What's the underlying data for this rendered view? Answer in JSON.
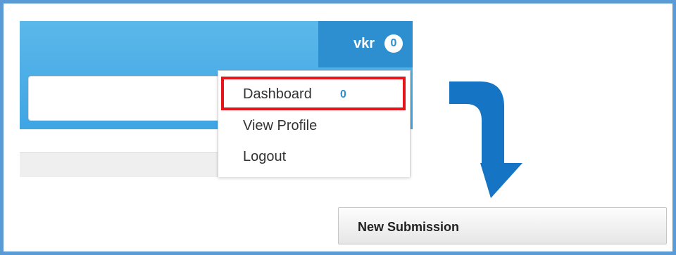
{
  "header": {
    "user_name": "vkr",
    "notification_count": "0"
  },
  "user_menu": {
    "items": [
      {
        "label": "Dashboard",
        "count": "0"
      },
      {
        "label": "View Profile"
      },
      {
        "label": "Logout"
      }
    ]
  },
  "actions": {
    "new_submission_label": "New Submission"
  },
  "colors": {
    "header_blue": "#3fa5e3",
    "user_tab_blue": "#2d8fcf",
    "highlight_red": "#e5151b",
    "arrow_blue": "#1574c4",
    "frame_blue": "#5b9bd5"
  },
  "icons": {
    "arrow": "curved-arrow-down-icon"
  }
}
